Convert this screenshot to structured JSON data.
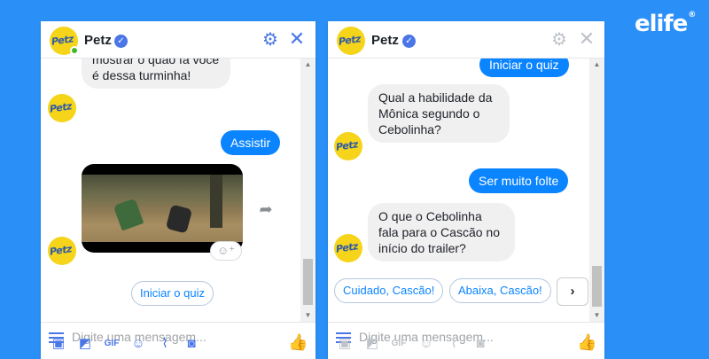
{
  "brand": {
    "name": "elife",
    "reg": "®"
  },
  "bot": {
    "name": "Petz",
    "logo_text": "Petz",
    "verified_icon": "check-badge-icon"
  },
  "colors": {
    "background": "#2a8ff7",
    "messenger_blue": "#0b84ff",
    "incoming_bubble": "#f1f0f0",
    "logo_yellow": "#f5d41a",
    "online_green": "#42b72a"
  },
  "chat1": {
    "messages": [
      {
        "from": "bot",
        "text": "mostrar o quão fã você é dessa turminha!"
      },
      {
        "from": "user",
        "text": "Assistir"
      },
      {
        "from": "bot",
        "type": "video"
      }
    ],
    "quick_reply": "Iniciar o quiz"
  },
  "chat2": {
    "messages": [
      {
        "from": "user",
        "text": "Iniciar o quiz"
      },
      {
        "from": "bot",
        "text": "Qual a habilidade da Mônica segundo o Cebolinha?"
      },
      {
        "from": "user",
        "text": "Ser muito folte"
      },
      {
        "from": "bot",
        "text": "O que o Cebolinha fala para o Cascão no início do trailer?"
      }
    ],
    "quick_replies": [
      "Cuidado, Cascão!",
      "Abaixa, Cascão!"
    ]
  },
  "composer": {
    "placeholder": "Digite uma mensagem...",
    "tools": [
      "image-icon",
      "sticker-icon",
      "gif-icon",
      "emoji-icon",
      "attachment-icon",
      "camera-icon"
    ],
    "gif_label": "GIF"
  }
}
